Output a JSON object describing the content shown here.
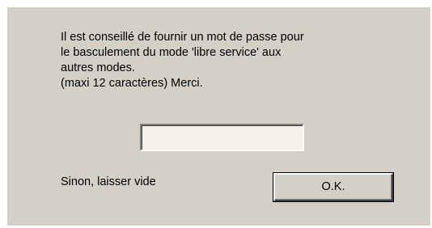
{
  "dialog": {
    "message_lines": [
      "Il est conseillé de fournir un mot de passe pour",
      "le basculement du mode 'libre service' aux",
      "autres modes.",
      "(maxi 12 caractères) Merci."
    ],
    "password_value": "",
    "hint": "Sinon, laisser vide",
    "ok_label": "O.K."
  },
  "colors": {
    "dialog_background": "#d4d0c8",
    "input_background": "#f3f1ea",
    "page_background": "#ffffff"
  }
}
